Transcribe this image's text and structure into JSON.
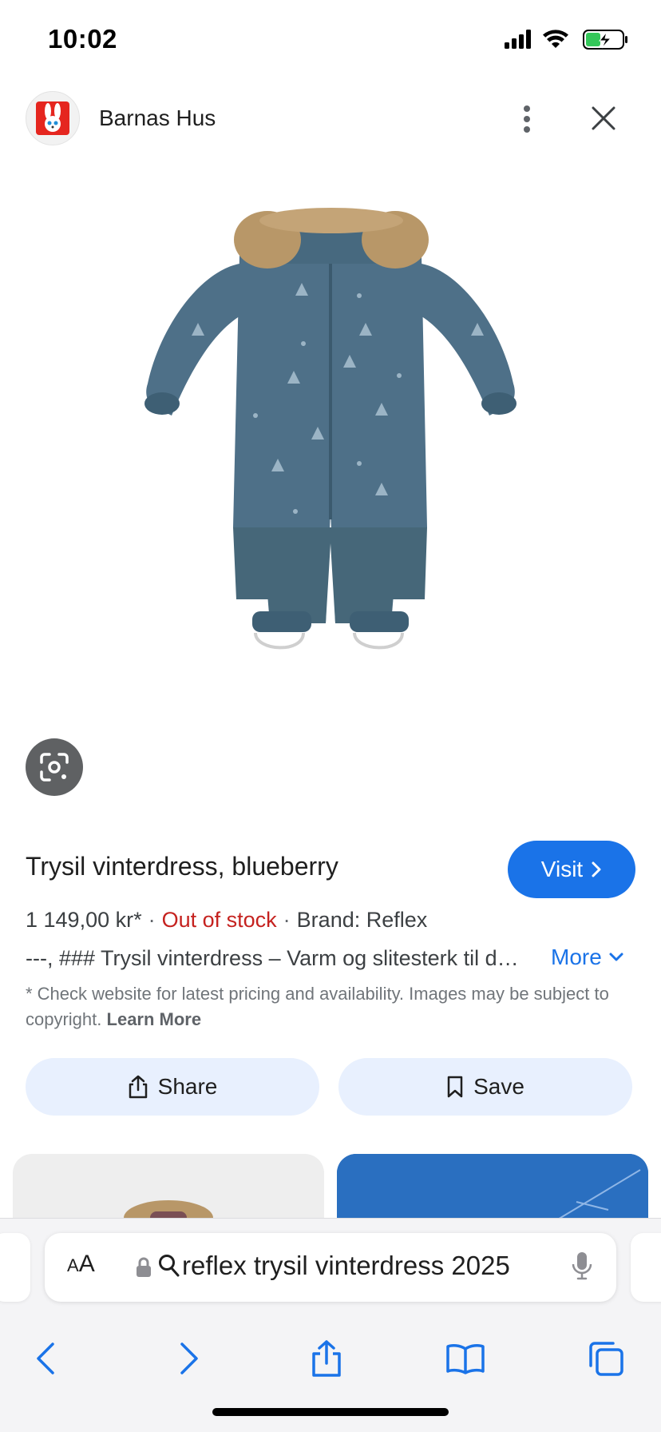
{
  "status_bar": {
    "time": "10:02",
    "icons": [
      "signal-icon",
      "wifi-icon",
      "battery-charging-icon"
    ]
  },
  "header": {
    "site_name": "Barnas Hus",
    "logo_icon": "bunny-logo-icon",
    "more_icon": "more-vertical-icon",
    "close_icon": "close-icon"
  },
  "product": {
    "image_alt": "Trysil vinterdress, blueberry",
    "title": "Trysil vinterdress, blueberry",
    "visit_label": "Visit",
    "price": "1 149,00 kr*",
    "stock": "Out of stock",
    "brand": "Brand: Reflex",
    "separator": "·",
    "description": "---, ### Trysil vinterdress – Varm og slitesterk til d…",
    "more_label": "More",
    "disclaimer": "* Check website for latest pricing and availability. Images may be subject to copyright.",
    "learn_more": "Learn More"
  },
  "actions": {
    "share_label": "Share",
    "save_label": "Save"
  },
  "browser": {
    "aa_label_small": "A",
    "aa_label_large": "A",
    "url_text": "reflex trysil vinterdress 2025",
    "toolbar": [
      "back-icon",
      "forward-icon",
      "share-icon",
      "bookmarks-icon",
      "tabs-icon"
    ]
  },
  "colors": {
    "accent": "#1a73e8",
    "out_of_stock": "#c5221f",
    "action_bg": "#e8f0fe",
    "suit": "#4e7088"
  }
}
